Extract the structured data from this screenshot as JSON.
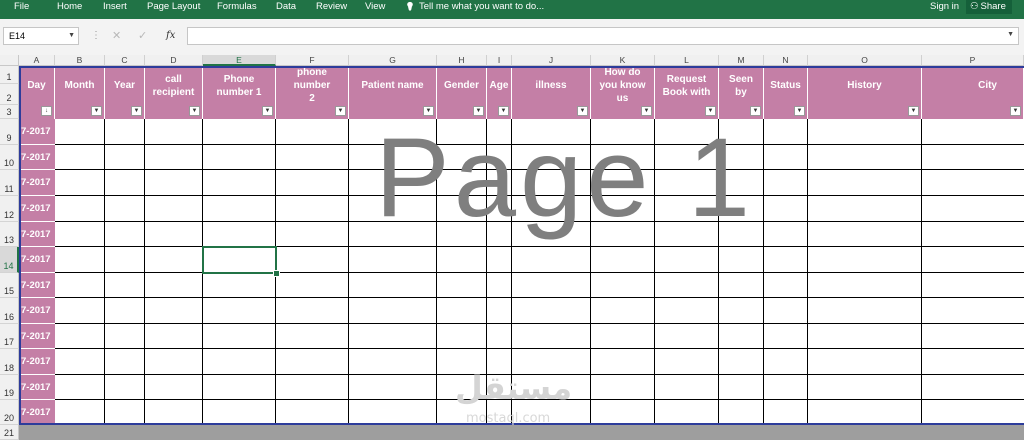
{
  "ribbon": {
    "tabs": [
      "File",
      "Home",
      "Insert",
      "Page Layout",
      "Formulas",
      "Data",
      "Review",
      "View"
    ],
    "tell_me": "Tell me what you want to do...",
    "sign_in": "Sign in",
    "share": "Share",
    "icons": {
      "tell": "lightbulb-icon",
      "share": "person-icon"
    }
  },
  "formula_bar": {
    "name_box": "E14",
    "fx_label": "fx",
    "value": ""
  },
  "columns": [
    "A",
    "B",
    "C",
    "D",
    "E",
    "F",
    "G",
    "H",
    "I",
    "J",
    "K",
    "L",
    "M",
    "N",
    "O",
    "P"
  ],
  "selected_column": "E",
  "header_labels": [
    "Day",
    "Month",
    "Year",
    "call\nrecipient",
    "Phone\nnumber 1",
    "phone\nnumber\n2",
    "Patient name",
    "Gender",
    "Age",
    "illness",
    "How do\nyou know\nus",
    "Request\nBook with",
    "Seen\nby",
    "Status",
    "History",
    "City"
  ],
  "rows": [
    1,
    2,
    3,
    9,
    10,
    11,
    12,
    13,
    14,
    15,
    16,
    17,
    18,
    19,
    20,
    21
  ],
  "selected_row": 14,
  "selected_cell": "E14",
  "day_value": "7-2017",
  "watermark": "Page 1",
  "branding": {
    "arabic": "مستقل",
    "latin": "mostaql.com"
  },
  "colors": {
    "header_fill": "#c47fa6",
    "excel_green": "#217346",
    "border_blue": "#2d3c9b"
  }
}
